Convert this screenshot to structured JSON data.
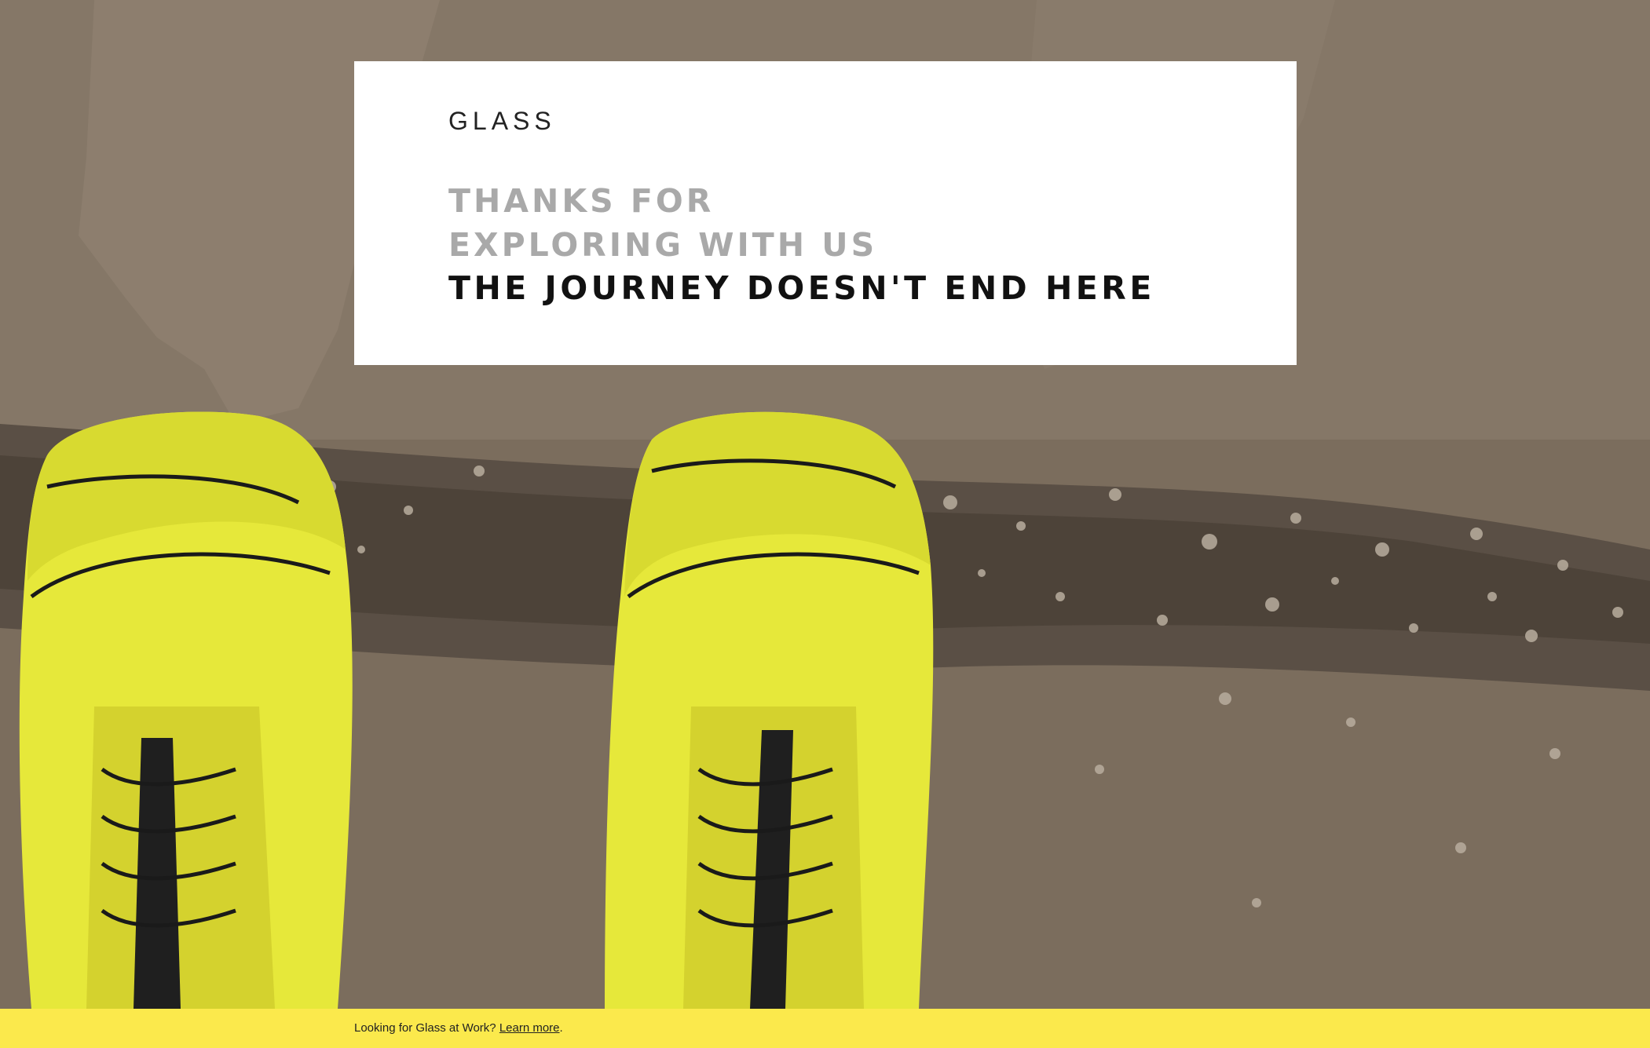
{
  "brand": {
    "logo_text": "GLASS"
  },
  "hero": {
    "headline_line1": "THANKS FOR",
    "headline_line2": "EXPLORING WITH US",
    "subheadline": "THE JOURNEY DOESN'T END HERE"
  },
  "footer": {
    "prompt": "Looking for Glass at Work?",
    "link_label": "Learn more",
    "trailing": "."
  },
  "colors": {
    "card_background": "#ffffff",
    "muted_headline": "#a9a9a9",
    "strong_headline": "#111111",
    "footer_background": "#fbe94c",
    "shoe_yellow": "#e6e83a",
    "mud": "#7d6f5f"
  }
}
